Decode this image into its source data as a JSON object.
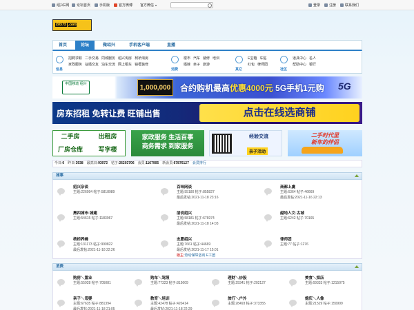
{
  "topbar": {
    "links": [
      "绍兴E网",
      "论坛首页",
      "手机版",
      "官方微博",
      "官方微信"
    ],
    "search_placeholder": "",
    "right": [
      "登录",
      "注册",
      "联系我们"
    ]
  },
  "logo": {
    "text": "E0575",
    "suffix": ".com"
  },
  "nav": {
    "tabs": [
      "首页",
      "论坛",
      "微绍兴",
      "手机客户端",
      "直播"
    ],
    "active": 1
  },
  "categories": [
    {
      "label": "信息",
      "links": [
        "招聘求职",
        "二手交易",
        "同城服务",
        "绍兴淘房",
        "柯桥淘房",
        "家政服务",
        "征婚交友",
        "泊车交流",
        "网上租车",
        "镜框装修"
      ]
    },
    {
      "label": "消费",
      "links": [
        "楼市",
        "汽车",
        "装修",
        "培训",
        "婚嫁",
        "亲子",
        "旅游"
      ]
    },
    {
      "label": "其它",
      "links": [
        "E宝箱",
        "车贴",
        "红包",
        "律师团"
      ]
    },
    {
      "label": "社区",
      "links": [
        "道具中心",
        "名人",
        "帮助中心",
        "银行"
      ]
    }
  ],
  "banner1": {
    "brand": "中国移动 绍兴",
    "amount": "1,000,000",
    "headline_a": "合约购机最高",
    "headline_b": "优惠4000元",
    "headline_c": " 5G手机1元购",
    "badge": "5G"
  },
  "banner2": {
    "left": "房东招租  免转让费  旺铺出售",
    "right": "点击在线选商铺"
  },
  "ads": {
    "ad1": [
      "二手房",
      "出租房",
      "厂房仓库",
      "写字楼"
    ],
    "ad2": [
      "家政服务  生活百事",
      "商务需求  到家服务"
    ],
    "ad3": [
      "经验交流",
      "亲子活动"
    ],
    "ad4": [
      "二手时代里",
      "新车的伴侣"
    ]
  },
  "stats": {
    "text_parts": [
      {
        "label": "今日:",
        "value": "0"
      },
      {
        "label": "昨日:",
        "value": "3938"
      },
      {
        "label": "最高日:",
        "value": "93072"
      },
      {
        "label": "帖子:",
        "value": "26203706"
      },
      {
        "label": "会员:",
        "value": "1167905"
      },
      {
        "label": "新会员:",
        "value": "67876127"
      },
      {
        "label": "",
        "value": "会员排行"
      }
    ]
  },
  "sections": [
    {
      "title": "城事",
      "forums": [
        {
          "name": "绍兴杂谈",
          "stat": "主题:226094   帖子:5818989",
          "post": ""
        },
        {
          "name": "百味网谈",
          "stat": "主题:55180   帖子:855827",
          "post": "最后发帖:2021-11-18 23:16"
        },
        {
          "name": "商都上虞",
          "stat": "主题:6364   帖子:46669",
          "post": "最后发帖:2021-11-16 22:13"
        },
        {
          "name": "黑四城市·城建",
          "stat": "主题:54615   帖子:1183967",
          "post": ""
        },
        {
          "name": "朋说绍兴",
          "stat": "主题:58181   帖子:676974",
          "post": "最后发帖:2021-11-18 14:03"
        },
        {
          "name": "越地人文·古城",
          "stat": "主题:6242   帖子:70165",
          "post": ""
        },
        {
          "name": "杨桥养蜂",
          "stat": "主题:131173   帖子:990822",
          "post": "最后发帖:2021-11-18 22:26"
        },
        {
          "name": "志愿绍兴",
          "stat": "主题:7661   帖子:44669",
          "post": "最后发帖:2021-11-17 15:01",
          "mod": "版主:",
          "modname": "劳动保障咨询 E工团"
        },
        {
          "name": "律师团",
          "stat": "主题:77   帖子:1276",
          "post": ""
        }
      ]
    },
    {
      "title": "消费",
      "forums": [
        {
          "name": "购房＼置业",
          "stat": "主题:55928   帖子:705081",
          "post": ""
        },
        {
          "name": "购车＼驾照",
          "stat": "主题:77323   帖子:815609",
          "post": ""
        },
        {
          "name": "理财＼炒股",
          "stat": "主题:29341   帖子:202127",
          "post": ""
        },
        {
          "name": "美食＼探店",
          "stat": "主题:69333   帖子:1215075",
          "post": ""
        },
        {
          "name": "亲子＼母婴",
          "stat": "主题:67635   帖子:881394",
          "post": "最后发帖:2021-11-18 21:05"
        },
        {
          "name": "教育＼培训",
          "stat": "主题:42478   帖子:420414",
          "post": "最后发帖:2021-11-18 22:29"
        },
        {
          "name": "旅行＼户外",
          "stat": "主题:28493   帖子:373355",
          "post": ""
        },
        {
          "name": "婚庆＼人像",
          "stat": "主题:21529   帖子:150999",
          "post": ""
        }
      ]
    }
  ],
  "colors": {
    "accent": "#2c7fc7",
    "logo_bg": "#f6c21a",
    "banner_yellow": "#ffd21f"
  }
}
